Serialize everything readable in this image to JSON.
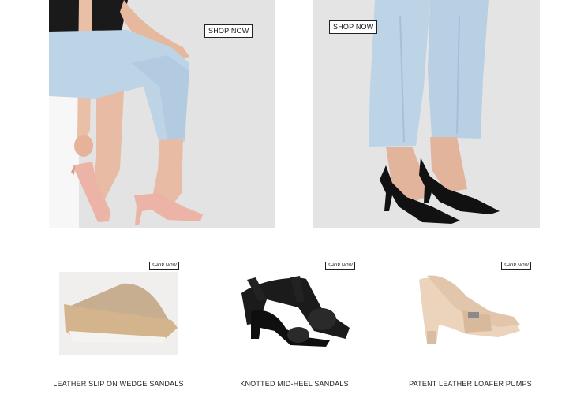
{
  "heroes": [
    {
      "cta": "SHOP NOW",
      "alt": "pink pointed slingback mules"
    },
    {
      "cta": "SHOP NOW",
      "alt": "black patent slingback pumps"
    }
  ],
  "products": [
    {
      "name": "LEATHER SLIP ON WEDGE SANDALS",
      "cta": "SHOP NOW"
    },
    {
      "name": "KNOTTED MID-HEEL SANDALS",
      "cta": "SHOP NOW"
    },
    {
      "name": "PATENT LEATHER LOAFER PUMPS",
      "cta": "SHOP NOW"
    }
  ],
  "colors": {
    "hero_bg": "#e4e4e4",
    "denim": "#bdd3e6",
    "pink_shoe": "#ebb4a6",
    "black_shoe": "#111111",
    "wedge_suede": "#c8ae90",
    "loafer": "#ecd3bb"
  }
}
